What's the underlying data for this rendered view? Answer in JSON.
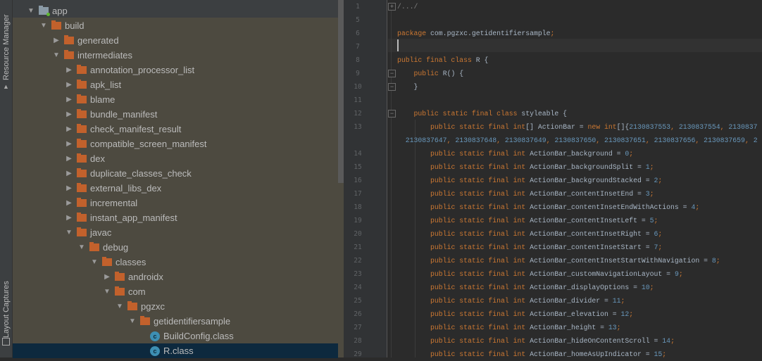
{
  "toolwindows": {
    "resource_manager": "Resource Manager",
    "layout_captures": "Layout Captures"
  },
  "tree": [
    {
      "label": "app",
      "level": 0,
      "state": "open",
      "icon": "module-folder-icon"
    },
    {
      "label": "build",
      "level": 1,
      "state": "open",
      "icon": "folder-icon"
    },
    {
      "label": "generated",
      "level": 2,
      "state": "closed",
      "icon": "folder-icon"
    },
    {
      "label": "intermediates",
      "level": 2,
      "state": "open",
      "icon": "folder-icon"
    },
    {
      "label": "annotation_processor_list",
      "level": 3,
      "state": "closed",
      "icon": "folder-icon"
    },
    {
      "label": "apk_list",
      "level": 3,
      "state": "closed",
      "icon": "folder-icon"
    },
    {
      "label": "blame",
      "level": 3,
      "state": "closed",
      "icon": "folder-icon"
    },
    {
      "label": "bundle_manifest",
      "level": 3,
      "state": "closed",
      "icon": "folder-icon"
    },
    {
      "label": "check_manifest_result",
      "level": 3,
      "state": "closed",
      "icon": "folder-icon"
    },
    {
      "label": "compatible_screen_manifest",
      "level": 3,
      "state": "closed",
      "icon": "folder-icon"
    },
    {
      "label": "dex",
      "level": 3,
      "state": "closed",
      "icon": "folder-icon"
    },
    {
      "label": "duplicate_classes_check",
      "level": 3,
      "state": "closed",
      "icon": "folder-icon"
    },
    {
      "label": "external_libs_dex",
      "level": 3,
      "state": "closed",
      "icon": "folder-icon"
    },
    {
      "label": "incremental",
      "level": 3,
      "state": "closed",
      "icon": "folder-icon"
    },
    {
      "label": "instant_app_manifest",
      "level": 3,
      "state": "closed",
      "icon": "folder-icon"
    },
    {
      "label": "javac",
      "level": 3,
      "state": "open",
      "icon": "folder-icon"
    },
    {
      "label": "debug",
      "level": 4,
      "state": "open",
      "icon": "folder-icon"
    },
    {
      "label": "classes",
      "level": 5,
      "state": "open",
      "icon": "folder-icon"
    },
    {
      "label": "androidx",
      "level": 6,
      "state": "closed",
      "icon": "folder-icon"
    },
    {
      "label": "com",
      "level": 6,
      "state": "open",
      "icon": "folder-icon"
    },
    {
      "label": "pgzxc",
      "level": 7,
      "state": "open",
      "icon": "folder-icon"
    },
    {
      "label": "getidentifiersample",
      "level": 8,
      "state": "open",
      "icon": "folder-icon"
    },
    {
      "label": "BuildConfig.class",
      "level": 9,
      "state": "leaf",
      "icon": "class-file-icon"
    },
    {
      "label": "R.class",
      "level": 9,
      "state": "leaf",
      "icon": "class-file-icon",
      "selected": true
    }
  ],
  "editor": {
    "lines": [
      {
        "num": "1",
        "tokens": [
          [
            "c",
            "/.../"
          ]
        ],
        "fold": "+"
      },
      {
        "num": "5",
        "tokens": []
      },
      {
        "num": "6",
        "tokens": [
          [
            "k",
            "package "
          ],
          [
            "",
            "com.pgzxc.getidentifiersample"
          ],
          [
            "k",
            ";"
          ]
        ]
      },
      {
        "num": "7",
        "tokens": [],
        "current": true
      },
      {
        "num": "8",
        "tokens": [
          [
            "k",
            "public final class "
          ],
          [
            "",
            "R {"
          ]
        ]
      },
      {
        "num": "9",
        "tokens": [
          [
            "",
            "    "
          ],
          [
            "k",
            "public "
          ],
          [
            "",
            "R() {"
          ]
        ],
        "fold": "-"
      },
      {
        "num": "10",
        "tokens": [
          [
            "",
            "    }"
          ]
        ],
        "fold": "-"
      },
      {
        "num": "11",
        "tokens": []
      },
      {
        "num": "12",
        "tokens": [
          [
            "",
            "    "
          ],
          [
            "k",
            "public static final class "
          ],
          [
            "",
            "styleable {"
          ]
        ],
        "fold": "-"
      },
      {
        "num": "13",
        "tokens": [
          [
            "",
            "        "
          ],
          [
            "k",
            "public static final int"
          ],
          [
            "",
            "[] ActionBar = "
          ],
          [
            "k",
            "new int"
          ],
          [
            "",
            "[]{"
          ],
          [
            "n",
            "2130837553"
          ],
          [
            "k",
            ", "
          ],
          [
            "n",
            "2130837554"
          ],
          [
            "k",
            ", "
          ],
          [
            "n",
            "2130837"
          ]
        ]
      },
      {
        "num": "",
        "tokens": [
          [
            "",
            "  "
          ],
          [
            "n",
            "2130837647"
          ],
          [
            "k",
            ", "
          ],
          [
            "n",
            "2130837648"
          ],
          [
            "k",
            ", "
          ],
          [
            "n",
            "2130837649"
          ],
          [
            "k",
            ", "
          ],
          [
            "n",
            "2130837650"
          ],
          [
            "k",
            ", "
          ],
          [
            "n",
            "2130837651"
          ],
          [
            "k",
            ", "
          ],
          [
            "n",
            "2130837656"
          ],
          [
            "k",
            ", "
          ],
          [
            "n",
            "2130837659"
          ],
          [
            "k",
            ", "
          ],
          [
            "n",
            "2"
          ]
        ]
      },
      {
        "num": "14",
        "tokens": [
          [
            "",
            "        "
          ],
          [
            "k",
            "public static final int "
          ],
          [
            "",
            "ActionBar_background = "
          ],
          [
            "n",
            "0"
          ],
          [
            "k",
            ";"
          ]
        ]
      },
      {
        "num": "15",
        "tokens": [
          [
            "",
            "        "
          ],
          [
            "k",
            "public static final int "
          ],
          [
            "",
            "ActionBar_backgroundSplit = "
          ],
          [
            "n",
            "1"
          ],
          [
            "k",
            ";"
          ]
        ]
      },
      {
        "num": "16",
        "tokens": [
          [
            "",
            "        "
          ],
          [
            "k",
            "public static final int "
          ],
          [
            "",
            "ActionBar_backgroundStacked = "
          ],
          [
            "n",
            "2"
          ],
          [
            "k",
            ";"
          ]
        ]
      },
      {
        "num": "17",
        "tokens": [
          [
            "",
            "        "
          ],
          [
            "k",
            "public static final int "
          ],
          [
            "",
            "ActionBar_contentInsetEnd = "
          ],
          [
            "n",
            "3"
          ],
          [
            "k",
            ";"
          ]
        ]
      },
      {
        "num": "18",
        "tokens": [
          [
            "",
            "        "
          ],
          [
            "k",
            "public static final int "
          ],
          [
            "",
            "ActionBar_contentInsetEndWithActions = "
          ],
          [
            "n",
            "4"
          ],
          [
            "k",
            ";"
          ]
        ]
      },
      {
        "num": "19",
        "tokens": [
          [
            "",
            "        "
          ],
          [
            "k",
            "public static final int "
          ],
          [
            "",
            "ActionBar_contentInsetLeft = "
          ],
          [
            "n",
            "5"
          ],
          [
            "k",
            ";"
          ]
        ]
      },
      {
        "num": "20",
        "tokens": [
          [
            "",
            "        "
          ],
          [
            "k",
            "public static final int "
          ],
          [
            "",
            "ActionBar_contentInsetRight = "
          ],
          [
            "n",
            "6"
          ],
          [
            "k",
            ";"
          ]
        ]
      },
      {
        "num": "21",
        "tokens": [
          [
            "",
            "        "
          ],
          [
            "k",
            "public static final int "
          ],
          [
            "",
            "ActionBar_contentInsetStart = "
          ],
          [
            "n",
            "7"
          ],
          [
            "k",
            ";"
          ]
        ]
      },
      {
        "num": "22",
        "tokens": [
          [
            "",
            "        "
          ],
          [
            "k",
            "public static final int "
          ],
          [
            "",
            "ActionBar_contentInsetStartWithNavigation = "
          ],
          [
            "n",
            "8"
          ],
          [
            "k",
            ";"
          ]
        ]
      },
      {
        "num": "23",
        "tokens": [
          [
            "",
            "        "
          ],
          [
            "k",
            "public static final int "
          ],
          [
            "",
            "ActionBar_customNavigationLayout = "
          ],
          [
            "n",
            "9"
          ],
          [
            "k",
            ";"
          ]
        ]
      },
      {
        "num": "24",
        "tokens": [
          [
            "",
            "        "
          ],
          [
            "k",
            "public static final int "
          ],
          [
            "",
            "ActionBar_displayOptions = "
          ],
          [
            "n",
            "10"
          ],
          [
            "k",
            ";"
          ]
        ]
      },
      {
        "num": "25",
        "tokens": [
          [
            "",
            "        "
          ],
          [
            "k",
            "public static final int "
          ],
          [
            "",
            "ActionBar_divider = "
          ],
          [
            "n",
            "11"
          ],
          [
            "k",
            ";"
          ]
        ]
      },
      {
        "num": "26",
        "tokens": [
          [
            "",
            "        "
          ],
          [
            "k",
            "public static final int "
          ],
          [
            "",
            "ActionBar_elevation = "
          ],
          [
            "n",
            "12"
          ],
          [
            "k",
            ";"
          ]
        ]
      },
      {
        "num": "27",
        "tokens": [
          [
            "",
            "        "
          ],
          [
            "k",
            "public static final int "
          ],
          [
            "",
            "ActionBar_height = "
          ],
          [
            "n",
            "13"
          ],
          [
            "k",
            ";"
          ]
        ]
      },
      {
        "num": "28",
        "tokens": [
          [
            "",
            "        "
          ],
          [
            "k",
            "public static final int "
          ],
          [
            "",
            "ActionBar_hideOnContentScroll = "
          ],
          [
            "n",
            "14"
          ],
          [
            "k",
            ";"
          ]
        ]
      },
      {
        "num": "29",
        "tokens": [
          [
            "",
            "        "
          ],
          [
            "k",
            "public static final int "
          ],
          [
            "",
            "ActionBar_homeAsUpIndicator = "
          ],
          [
            "n",
            "15"
          ],
          [
            "k",
            ";"
          ]
        ]
      }
    ]
  }
}
